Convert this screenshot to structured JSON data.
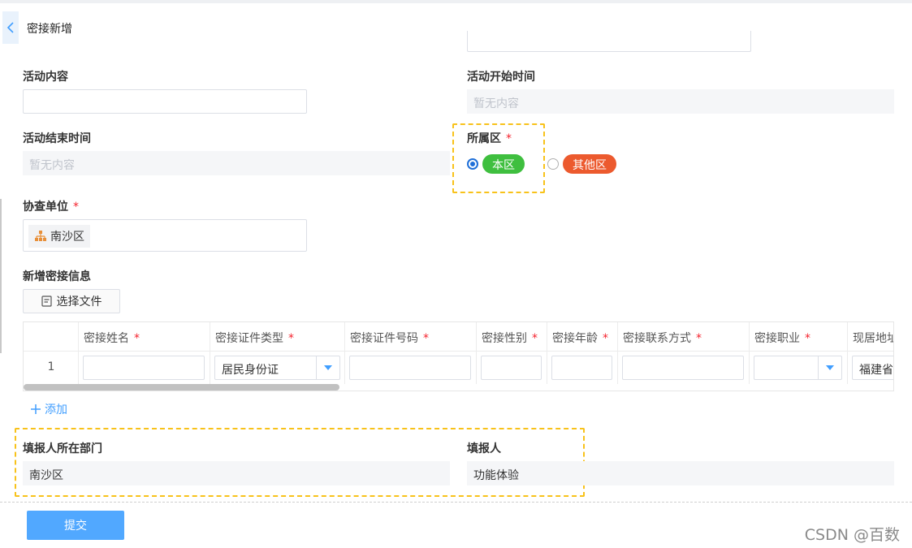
{
  "header": {
    "title": "密接新增"
  },
  "form": {
    "activity_content": {
      "label": "活动内容",
      "value": ""
    },
    "activity_start": {
      "label": "活动开始时间",
      "placeholder": "暂无内容"
    },
    "activity_end": {
      "label": "活动结束时间",
      "placeholder": "暂无内容"
    },
    "district": {
      "label": "所属区",
      "required_mark": "*",
      "options": [
        {
          "label": "本区",
          "selected": true,
          "color": "#3fbf3f"
        },
        {
          "label": "其他区",
          "selected": false,
          "color": "#ec5a2e"
        }
      ]
    },
    "assist_unit": {
      "label": "协查单位",
      "required_mark": "*",
      "tag": "南沙区",
      "tag_icon": "org-tree-icon"
    },
    "new_contact_info": {
      "label": "新增密接信息",
      "file_button": "选择文件",
      "file_icon": "document-icon"
    },
    "table": {
      "columns": [
        {
          "label": "",
          "required_mark": ""
        },
        {
          "label": "密接姓名",
          "required_mark": "*"
        },
        {
          "label": "密接证件类型",
          "required_mark": "*"
        },
        {
          "label": "密接证件号码",
          "required_mark": "*"
        },
        {
          "label": "密接性别",
          "required_mark": "*"
        },
        {
          "label": "密接年龄",
          "required_mark": "*"
        },
        {
          "label": "密接联系方式",
          "required_mark": "*"
        },
        {
          "label": "密接职业",
          "required_mark": "*"
        },
        {
          "label": "现居地址",
          "required_mark": ""
        }
      ],
      "rows": [
        {
          "index": "1",
          "name": "",
          "id_type": "居民身份证",
          "id_number": "",
          "gender": "",
          "age": "",
          "phone": "",
          "occupation": "",
          "address": "福建省厦门"
        }
      ]
    },
    "add_link": "添加",
    "reporter_dept": {
      "label": "填报人所在部门",
      "value": "南沙区"
    },
    "reporter": {
      "label": "填报人",
      "value": "功能体验"
    }
  },
  "footer": {
    "submit": "提交"
  },
  "watermark": "CSDN @百数",
  "colors": {
    "accent": "#409eff",
    "highlight": "#f8c21a",
    "required": "#f5222d"
  }
}
